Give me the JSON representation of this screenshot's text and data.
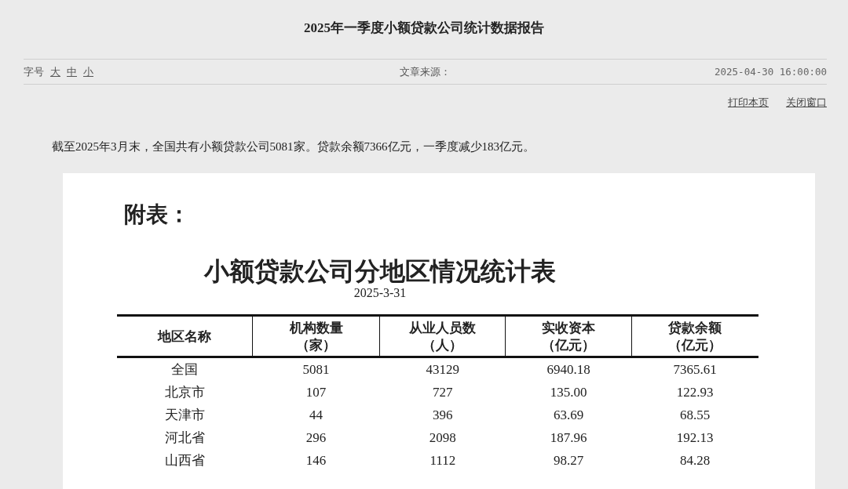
{
  "page_title": "2025年一季度小额贷款公司统计数据报告",
  "meta": {
    "font_size_label": "字号",
    "font_sizes": [
      "大",
      "中",
      "小"
    ],
    "source_label": "文章来源：",
    "datetime": "2025-04-30 16:00:00"
  },
  "actions": [
    "打印本页",
    "关闭窗口"
  ],
  "summary": "截至2025年3月末，全国共有小额贷款公司5081家。贷款余额7366亿元，一季度减少183亿元。",
  "attachment": {
    "label": "附表：",
    "table_title": "小额贷款公司分地区情况统计表",
    "table_date": "2025-3-31",
    "columns": [
      {
        "name": "地区名称"
      },
      {
        "name": "机构数量",
        "unit": "（家）"
      },
      {
        "name": "从业人员数",
        "unit": "（人）"
      },
      {
        "name": "实收资本",
        "unit": "（亿元）"
      },
      {
        "name": "贷款余额",
        "unit": "（亿元）"
      }
    ],
    "rows": [
      [
        "全国",
        "5081",
        "43129",
        "6940.18",
        "7365.61"
      ],
      [
        "北京市",
        "107",
        "727",
        "135.00",
        "122.93"
      ],
      [
        "天津市",
        "44",
        "396",
        "63.69",
        "68.55"
      ],
      [
        "河北省",
        "296",
        "2098",
        "187.96",
        "192.13"
      ],
      [
        "山西省",
        "146",
        "1112",
        "98.27",
        "84.28"
      ]
    ]
  }
}
